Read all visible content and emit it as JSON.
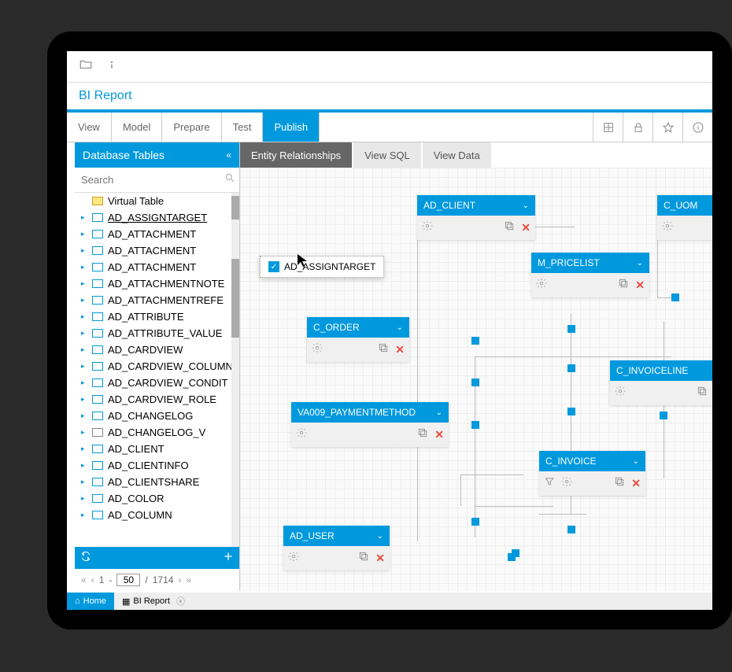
{
  "title": "BI Report",
  "tabs": [
    "View",
    "Model",
    "Prepare",
    "Test",
    "Publish"
  ],
  "active_tab": "Publish",
  "sidebar": {
    "header": "Database Tables",
    "search_placeholder": "Search",
    "root": "Virtual Table",
    "items": [
      "AD_ASSIGNTARGET",
      "AD_ATTACHMENT",
      "AD_ATTACHMENT",
      "AD_ATTACHMENT",
      "AD_ATTACHMENTNOTE",
      "AD_ATTACHMENTREFE",
      "AD_ATTRIBUTE",
      "AD_ATTRIBUTE_VALUE",
      "AD_CARDVIEW",
      "AD_CARDVIEW_COLUMN",
      "AD_CARDVIEW_CONDIT",
      "AD_CARDVIEW_ROLE",
      "AD_CHANGELOG",
      "AD_CHANGELOG_V",
      "AD_CLIENT",
      "AD_CLIENTINFO",
      "AD_CLIENTSHARE",
      "AD_COLOR",
      "AD_COLUMN"
    ],
    "page_from": "1",
    "page_to": "50",
    "page_total": "1714"
  },
  "canvas_tabs": [
    "Entity Relationships",
    "View SQL",
    "View Data"
  ],
  "active_canvas_tab": "Entity Relationships",
  "entities": {
    "ad_client": "AD_CLIENT",
    "c_uom": "C_UOM",
    "ad_assigntarget": "AD_ASSIGNTARGET",
    "m_pricelist": "M_PRICELIST",
    "c_order": "C_ORDER",
    "c_invoiceline": "C_INVOICELINE",
    "va009": "VA009_PAYMENTMETHOD",
    "c_invoice": "C_INVOICE",
    "ad_user": "AD_USER"
  },
  "bottom_tabs": {
    "home": "Home",
    "report": "BI Report"
  }
}
